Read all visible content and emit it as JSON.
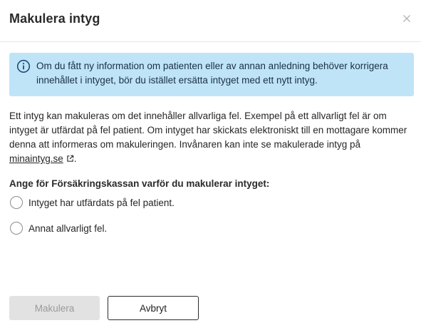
{
  "dialog": {
    "title": "Makulera intyg",
    "close_icon": "close-icon"
  },
  "info": {
    "icon": "info-icon",
    "text": "Om du fått ny information om patienten eller av annan anledning behöver korrigera innehållet i intyget, bör du istället ersätta intyget med ett nytt intyg."
  },
  "body": {
    "text": "Ett intyg kan makuleras om det innehåller allvarliga fel. Exempel på ett allvarligt fel är om intyget är utfärdat på fel patient. Om intyget har skickats elektroniskt till en mottagare kommer denna att informeras om makuleringen. Invånaren kan inte se makulerade intyg på ",
    "link_text": "minaintyg.se",
    "link_icon": "external-link-icon",
    "after_link": "."
  },
  "question": {
    "label": "Ange för Försäkringskassan varför du makulerar intyget:",
    "options": [
      {
        "label": "Intyget har utfärdats på fel patient.",
        "selected": false
      },
      {
        "label": "Annat allvarligt fel.",
        "selected": false
      }
    ]
  },
  "buttons": {
    "primary_label": "Makulera",
    "primary_enabled": false,
    "secondary_label": "Avbryt"
  },
  "colors": {
    "info_background": "#bfe4f7",
    "info_icon": "#1f4e79",
    "disabled_button": "#e2e2e2"
  }
}
